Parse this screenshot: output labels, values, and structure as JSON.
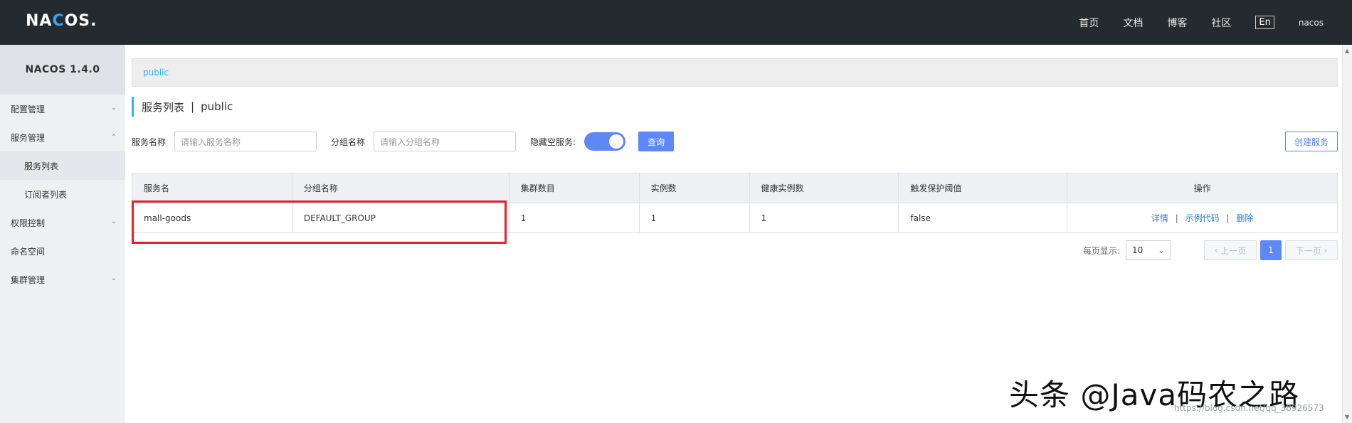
{
  "header": {
    "logo": "NACOS.",
    "nav": [
      "首页",
      "文档",
      "博客",
      "社区"
    ],
    "lang": "En",
    "user": "nacos"
  },
  "sidebar": {
    "title": "NACOS 1.4.0",
    "items": [
      {
        "label": "配置管理"
      },
      {
        "label": "服务管理"
      },
      {
        "label": "服务列表"
      },
      {
        "label": "订阅者列表"
      },
      {
        "label": "权限控制"
      },
      {
        "label": "命名空间"
      },
      {
        "label": "集群管理"
      }
    ]
  },
  "breadcrumb": {
    "label": "public"
  },
  "page_title": {
    "main": "服务列表",
    "sep": "|",
    "ns": "public"
  },
  "filters": {
    "service_name_label": "服务名称",
    "service_name_placeholder": "请输入服务名称",
    "group_name_label": "分组名称",
    "group_name_placeholder": "请输入分组名称",
    "hide_empty_label": "隐藏空服务:",
    "query_label": "查询",
    "create_label": "创建服务"
  },
  "table": {
    "headers": [
      "服务名",
      "分组名称",
      "集群数目",
      "实例数",
      "健康实例数",
      "触发保护阈值",
      "操作"
    ],
    "rows": [
      {
        "service": "mall-goods",
        "group": "DEFAULT_GROUP",
        "clusters": "1",
        "instances": "1",
        "healthy": "1",
        "threshold": "false"
      }
    ],
    "ops": [
      "详情",
      "示例代码",
      "删除"
    ],
    "op_sep": "|"
  },
  "pager": {
    "page_size_label": "每页显示:",
    "page_size": "10",
    "prev": "上一页",
    "current": "1",
    "next": "下一页"
  },
  "watermark": {
    "text": "头条 @Java码农之路",
    "url": "https://blog.csdn.net/qq_38926573"
  }
}
